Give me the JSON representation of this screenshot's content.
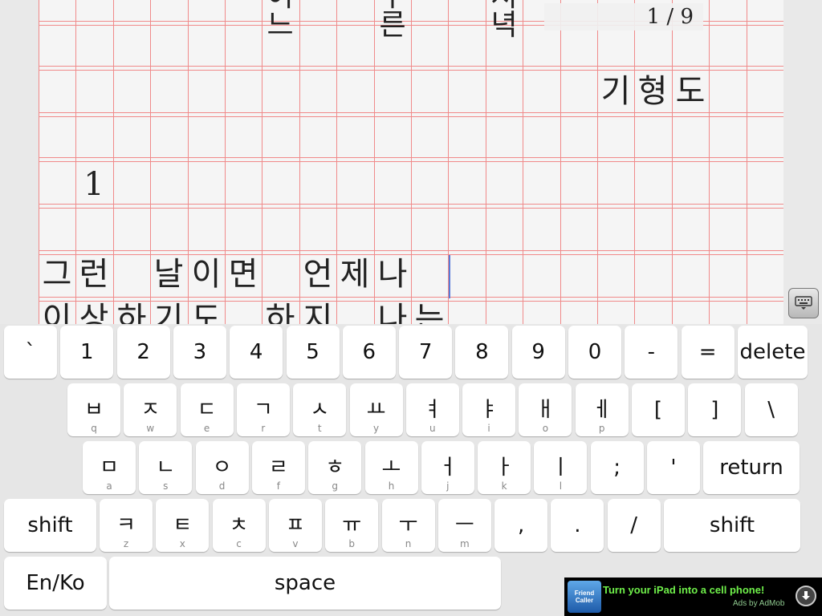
{
  "document": {
    "top_row_partial": [
      "어느",
      "푸른",
      "저녁"
    ],
    "author": [
      "기",
      "형",
      "도"
    ],
    "section_number": "1",
    "line1": [
      "그",
      "런",
      "날",
      "이",
      "면",
      "언",
      "제",
      "나"
    ],
    "line2_partial": [
      "이",
      "상",
      "하",
      "기",
      "도",
      "하",
      "지",
      "나",
      "는"
    ],
    "page_counter": "1 / 9"
  },
  "keyboard": {
    "row1": [
      {
        "main": "`"
      },
      {
        "main": "1"
      },
      {
        "main": "2"
      },
      {
        "main": "3"
      },
      {
        "main": "4"
      },
      {
        "main": "5"
      },
      {
        "main": "6"
      },
      {
        "main": "7"
      },
      {
        "main": "8"
      },
      {
        "main": "9"
      },
      {
        "main": "0"
      },
      {
        "main": "-"
      },
      {
        "main": "="
      },
      {
        "main": "delete"
      }
    ],
    "row2": [
      {
        "main": "ㅂ",
        "sub": "q"
      },
      {
        "main": "ㅈ",
        "sub": "w"
      },
      {
        "main": "ㄷ",
        "sub": "e"
      },
      {
        "main": "ㄱ",
        "sub": "r"
      },
      {
        "main": "ㅅ",
        "sub": "t"
      },
      {
        "main": "ㅛ",
        "sub": "y"
      },
      {
        "main": "ㅕ",
        "sub": "u"
      },
      {
        "main": "ㅑ",
        "sub": "i"
      },
      {
        "main": "ㅐ",
        "sub": "o"
      },
      {
        "main": "ㅔ",
        "sub": "p"
      },
      {
        "main": "["
      },
      {
        "main": "]"
      },
      {
        "main": "\\"
      }
    ],
    "row3": [
      {
        "main": "ㅁ",
        "sub": "a"
      },
      {
        "main": "ㄴ",
        "sub": "s"
      },
      {
        "main": "ㅇ",
        "sub": "d"
      },
      {
        "main": "ㄹ",
        "sub": "f"
      },
      {
        "main": "ㅎ",
        "sub": "g"
      },
      {
        "main": "ㅗ",
        "sub": "h"
      },
      {
        "main": "ㅓ",
        "sub": "j"
      },
      {
        "main": "ㅏ",
        "sub": "k"
      },
      {
        "main": "ㅣ",
        "sub": "l"
      },
      {
        "main": ";"
      },
      {
        "main": "'"
      },
      {
        "main": "return"
      }
    ],
    "row4": [
      {
        "main": "shift"
      },
      {
        "main": "ㅋ",
        "sub": "z"
      },
      {
        "main": "ㅌ",
        "sub": "x"
      },
      {
        "main": "ㅊ",
        "sub": "c"
      },
      {
        "main": "ㅍ",
        "sub": "v"
      },
      {
        "main": "ㅠ",
        "sub": "b"
      },
      {
        "main": "ㅜ",
        "sub": "n"
      },
      {
        "main": "ㅡ",
        "sub": "m"
      },
      {
        "main": ","
      },
      {
        "main": "."
      },
      {
        "main": "/"
      },
      {
        "main": "shift"
      }
    ],
    "row5": [
      {
        "main": "En/Ko"
      },
      {
        "main": "space"
      }
    ]
  },
  "ad": {
    "logo_line1": "Friend",
    "logo_line2": "Caller",
    "text": "Turn your iPad into a cell phone!",
    "by": "Ads by AdMob"
  },
  "icons": {
    "keyboard_toggle": "keyboard-hide-icon",
    "ad_download": "download-icon"
  },
  "colors": {
    "grid_line": "#f08a8a",
    "cursor": "#5a7bd8",
    "ad_text": "#6ff04a"
  }
}
